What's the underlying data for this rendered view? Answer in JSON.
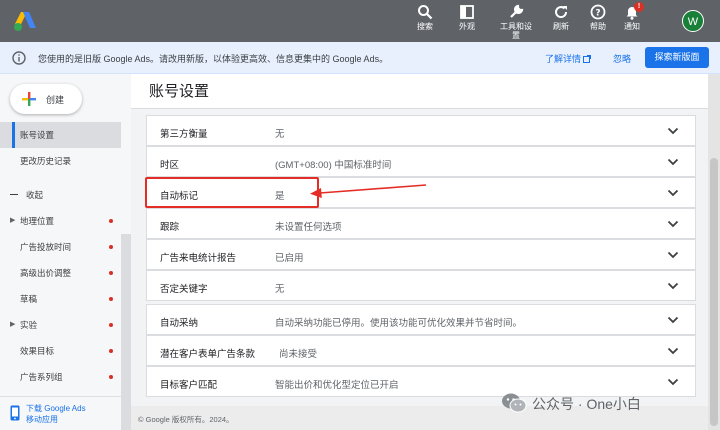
{
  "topbar": {
    "items": [
      {
        "label": "搜索",
        "icon": "search-icon"
      },
      {
        "label": "外观",
        "icon": "appearance-icon"
      },
      {
        "label": "工具和设置",
        "icon": "tools-icon"
      },
      {
        "label": "刷新",
        "icon": "refresh-icon"
      },
      {
        "label": "帮助",
        "icon": "help-icon"
      },
      {
        "label": "通知",
        "icon": "bell-icon",
        "badge": "!"
      }
    ],
    "avatar": "W"
  },
  "banner": {
    "message": "您使用的是旧版 Google Ads。请改用新版，以体验更高效、信息更集中的 Google Ads。",
    "learn_more": "了解详情",
    "ignore": "忽略",
    "explore": "探索新版面"
  },
  "sidebar": {
    "create": "创建",
    "items": [
      {
        "label": "账号设置",
        "active": true
      },
      {
        "label": "更改历史记录"
      },
      {
        "label": "收起",
        "collapse": true
      },
      {
        "label": "地理位置",
        "caret": true,
        "dot": true
      },
      {
        "label": "广告投放时间",
        "dot": true
      },
      {
        "label": "高级出价调整",
        "dot": true
      },
      {
        "label": "草稿",
        "dot": true
      },
      {
        "label": "实验",
        "caret": true,
        "dot": true
      },
      {
        "label": "效果目标",
        "dot": true
      },
      {
        "label": "广告系列组",
        "dot": true
      }
    ],
    "app_line1": "下载 Google Ads",
    "app_line2": "移动应用"
  },
  "main": {
    "title": "账号设置",
    "rows": [
      {
        "label": "第三方衡量",
        "value": "无"
      },
      {
        "label": "时区",
        "value": "(GMT+08:00) 中国标准时间"
      },
      {
        "label": "自动标记",
        "value": "是"
      },
      {
        "label": "跟踪",
        "value": "未设置任何选项"
      },
      {
        "label": "广告来电统计报告",
        "value": "已启用"
      },
      {
        "label": "否定关键字",
        "value": "无"
      },
      {
        "label": "自动采纳",
        "value": "自动采纳功能已停用。使用该功能可优化效果并节省时间。"
      },
      {
        "label": "潜在客户表单广告条款",
        "value": "尚未接受"
      },
      {
        "label": "目标客户匹配",
        "value": "智能出价和优化型定位已开启"
      }
    ],
    "footer": "© Google 版权所有。2024。"
  },
  "watermark": "公众号 · One小白",
  "colors": {
    "topbar": "#5f6368",
    "accent": "#1a73e8",
    "annotation": "#e52d27"
  }
}
